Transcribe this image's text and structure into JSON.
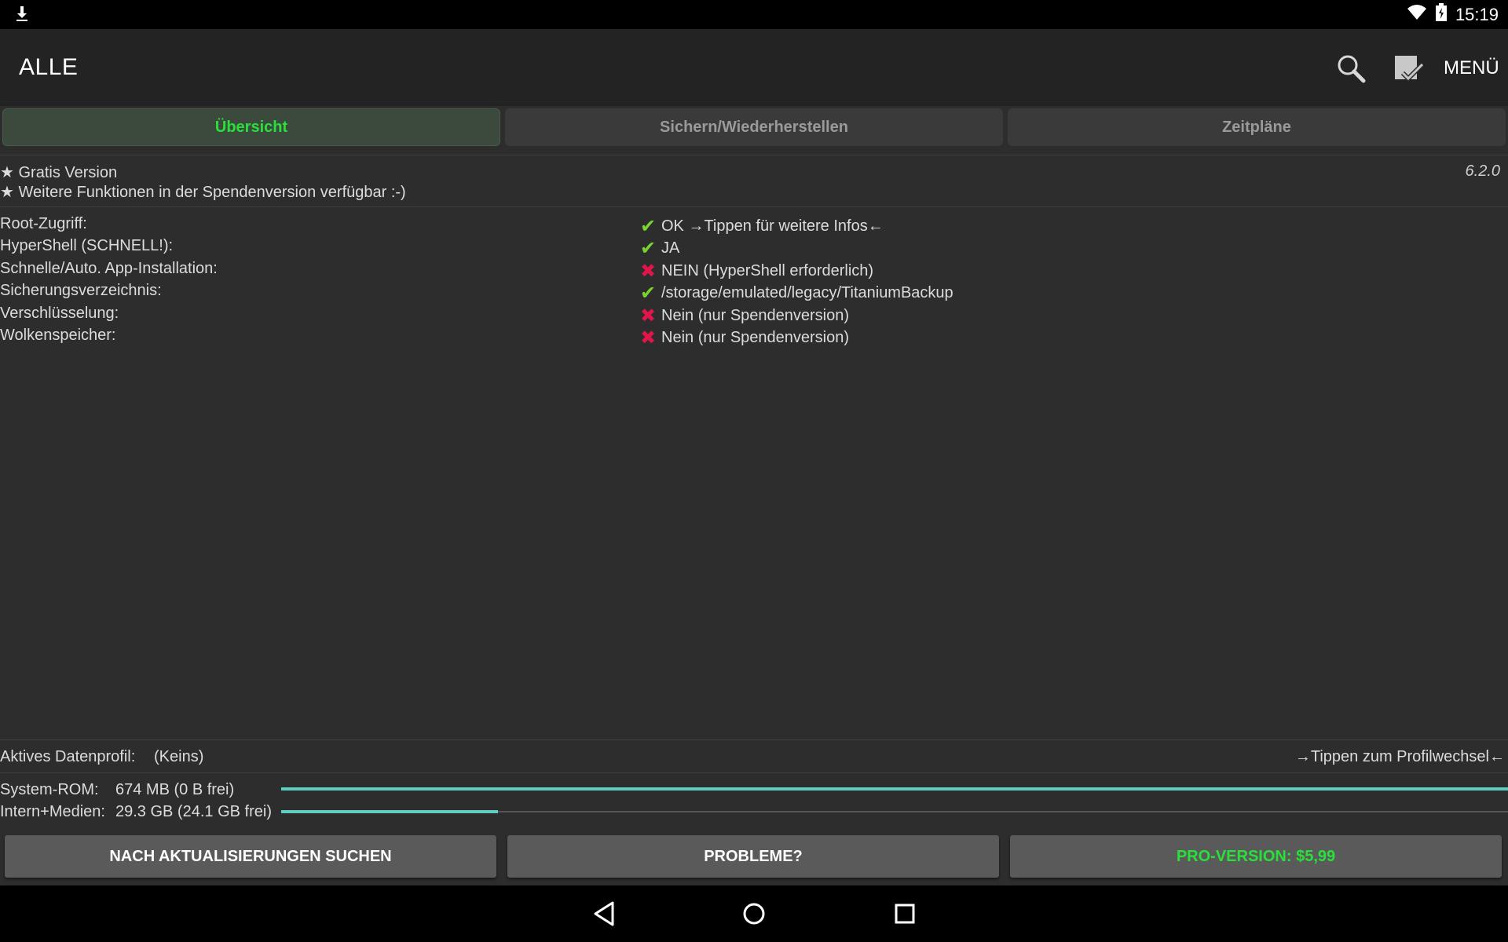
{
  "status_bar": {
    "time": "15:19",
    "icons": [
      "download-icon",
      "wifi-icon",
      "battery-icon"
    ]
  },
  "action_bar": {
    "title": "ALLE",
    "menu_label": "MENÜ"
  },
  "tabs": [
    {
      "label": "Übersicht",
      "active": true
    },
    {
      "label": "Sichern/Wiederherstellen",
      "active": false
    },
    {
      "label": "Zeitpläne",
      "active": false
    }
  ],
  "header": {
    "line1": "★ Gratis Version",
    "line2": "★ Weitere Funktionen in der Spendenversion verfügbar :-)",
    "version": "6.2.0"
  },
  "info": [
    {
      "label": "Root-Zugriff:",
      "status": "ok",
      "value": "OK →Tippen für weitere Infos←"
    },
    {
      "label": "HyperShell (SCHNELL!):",
      "status": "ok",
      "value": "JA"
    },
    {
      "label": "Schnelle/Auto. App-Installation:",
      "status": "no",
      "value": "NEIN (HyperShell erforderlich)"
    },
    {
      "label": "Sicherungsverzeichnis:",
      "status": "ok",
      "value": "/storage/emulated/legacy/TitaniumBackup"
    },
    {
      "label": "Verschlüsselung:",
      "status": "no",
      "value": "Nein (nur Spendenversion)"
    },
    {
      "label": "Wolkenspeicher:",
      "status": "no",
      "value": "Nein (nur Spendenversion)"
    }
  ],
  "profile": {
    "label": "Aktives Datenprofil:",
    "value": "(Keins)",
    "hint": "→Tippen zum Profilwechsel←"
  },
  "storage": [
    {
      "label": "System-ROM:",
      "value": "674 MB (0 B frei)",
      "used_fraction": 1.0
    },
    {
      "label": "Intern+Medien:",
      "value": "29.3 GB (24.1 GB frei)",
      "used_fraction": 0.177
    }
  ],
  "buttons": {
    "updates": "NACH AKTUALISIERUNGEN SUCHEN",
    "problems": "PROBLEME?",
    "pro": "PRO-VERSION: $5,99"
  },
  "colors": {
    "accent_green": "#29e03b",
    "check_green": "#7bd42d",
    "cross_red": "#e0154a",
    "bar_teal": "#5fd0c0"
  }
}
